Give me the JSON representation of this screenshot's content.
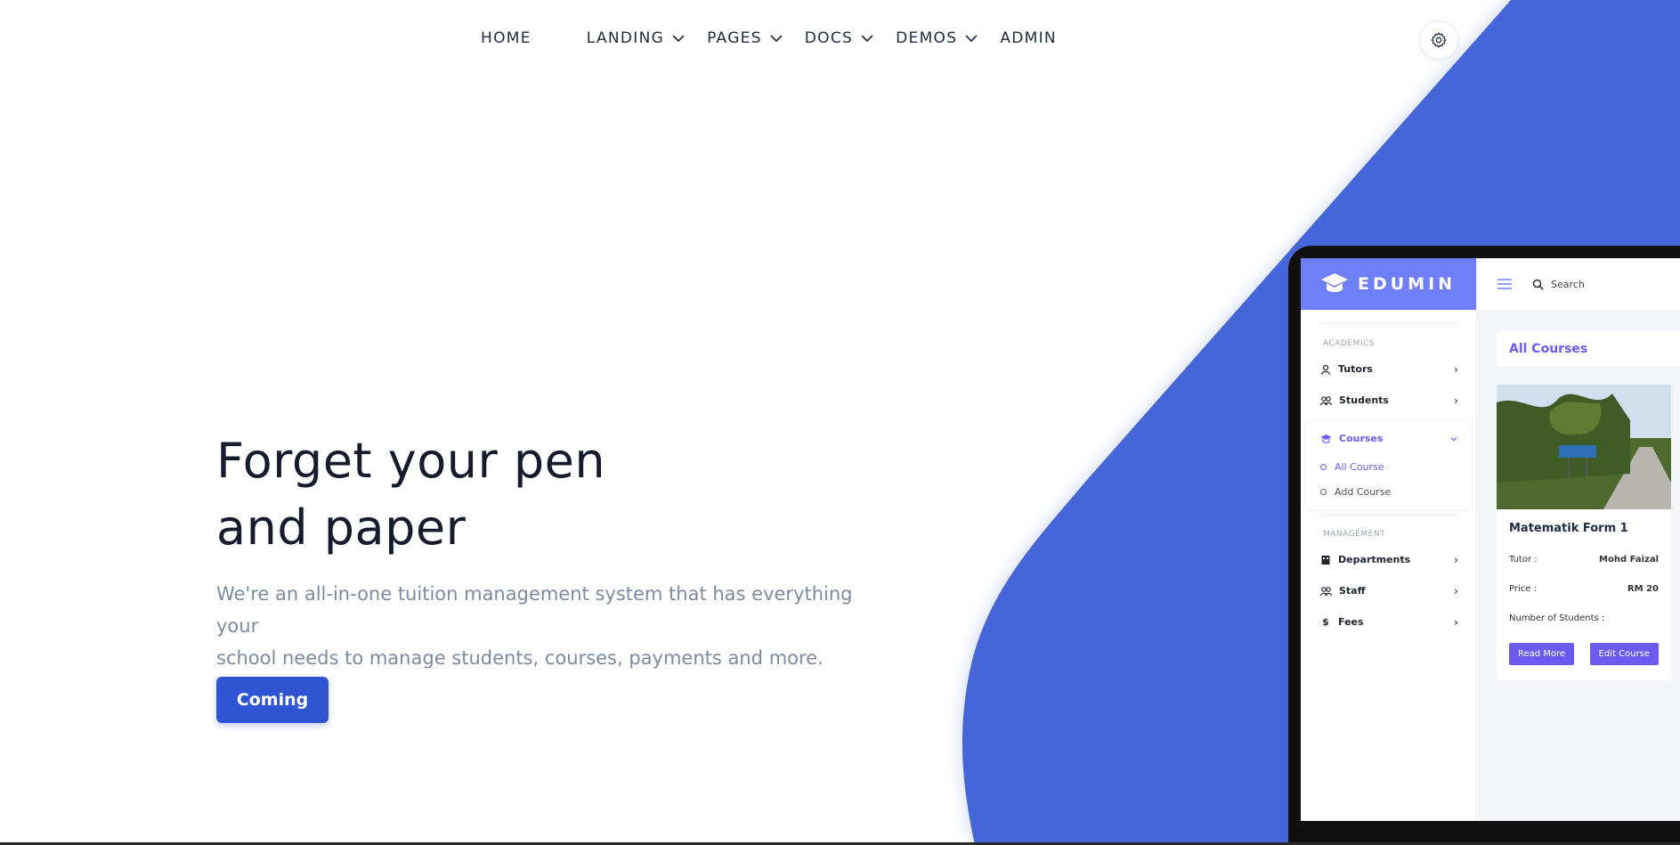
{
  "nav": {
    "items": [
      {
        "label": "HOME",
        "has_dropdown": false
      },
      {
        "label": "LANDING",
        "has_dropdown": true
      },
      {
        "label": "PAGES",
        "has_dropdown": true
      },
      {
        "label": "DOCS",
        "has_dropdown": true
      },
      {
        "label": "DEMOS",
        "has_dropdown": true
      },
      {
        "label": "ADMIN",
        "has_dropdown": false
      }
    ],
    "settings_icon": "gear-icon"
  },
  "hero": {
    "title_line1": "Forget your pen",
    "title_line2": "and paper",
    "subtitle_line1": "We're an all-in-one tuition management system that has everything your",
    "subtitle_line2": "school needs to manage students, courses, payments and more.",
    "cta_label": "Coming"
  },
  "colors": {
    "accent_blue": "#4466d8",
    "cta_blue": "#2f55d4",
    "app_purple": "#6b5bf2",
    "brand_bg": "#6f7ff7"
  },
  "app": {
    "brand": "EDUMIN",
    "search_placeholder": "Search",
    "sections": {
      "academics": "ACADEMICS",
      "management": "MANAGEMENT"
    },
    "sidebar": {
      "tutors": "Tutors",
      "students": "Students",
      "courses": "Courses",
      "all_course": "All Course",
      "add_course": "Add Course",
      "departments": "Departments",
      "staff": "Staff",
      "fees": "Fees"
    },
    "page_title": "All Courses",
    "course": {
      "title": "Matematik Form 1",
      "tutor_label": "Tutor :",
      "tutor_value": "Mohd Faizal",
      "price_label": "Price :",
      "price_value": "RM 20",
      "students_label": "Number of Students :",
      "read_more": "Read More",
      "edit_course": "Edit Course"
    }
  }
}
